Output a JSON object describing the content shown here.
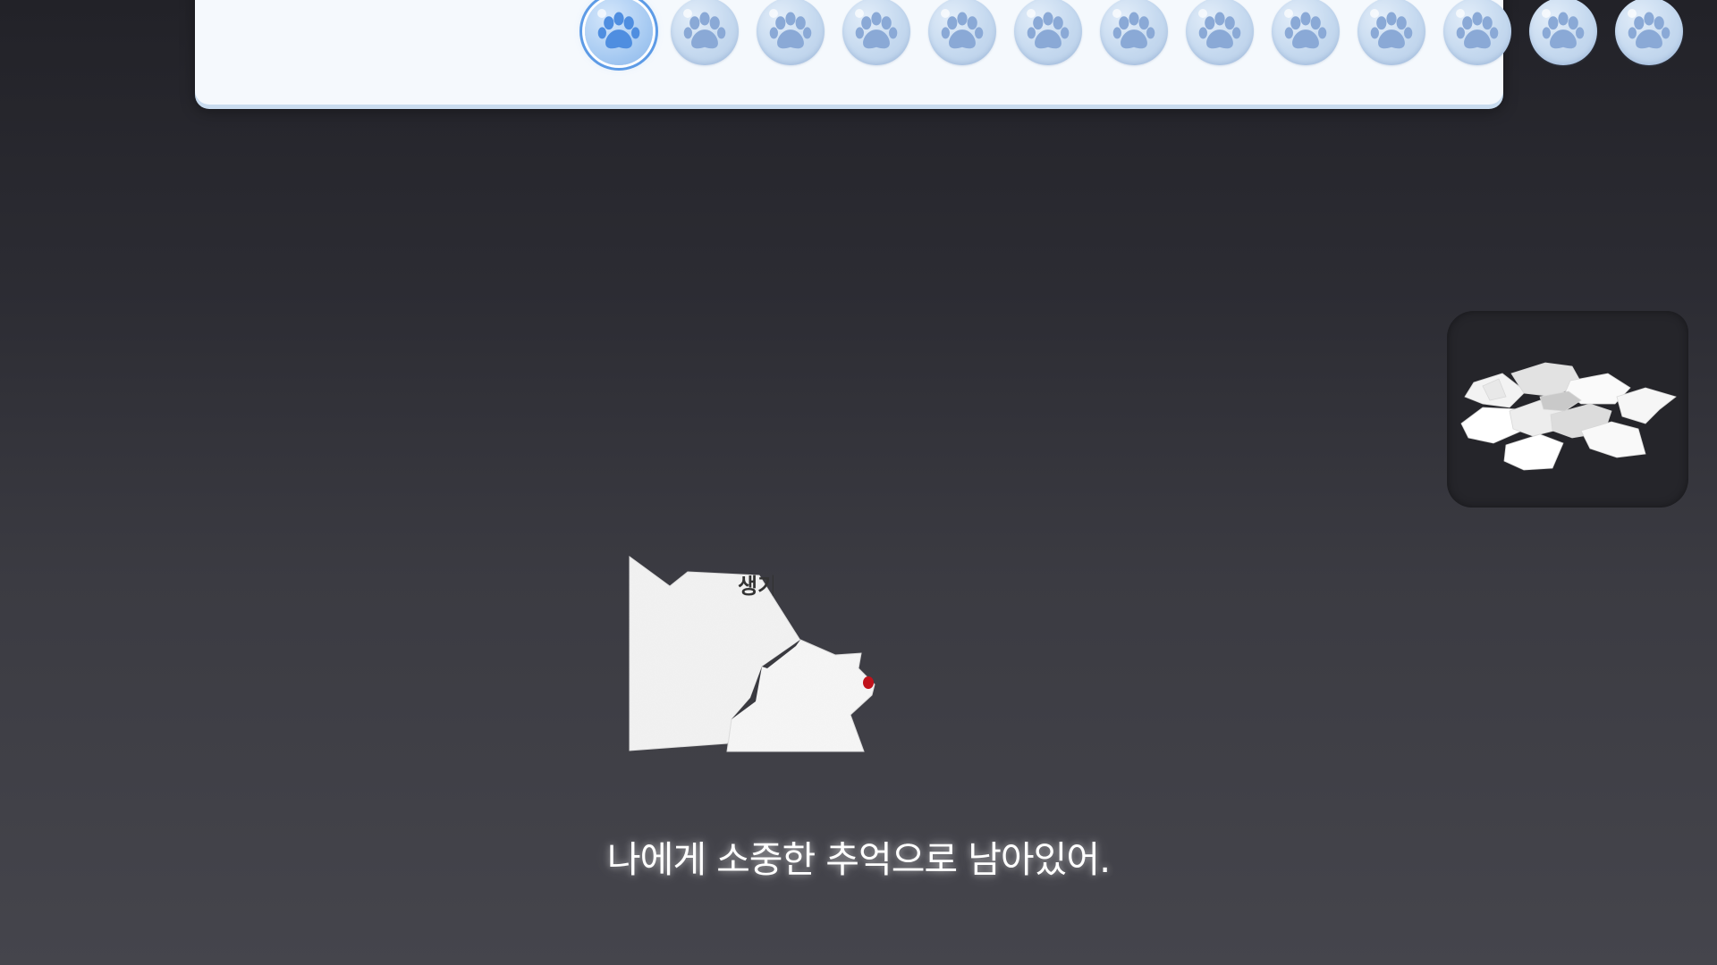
{
  "stages": {
    "count": 13,
    "active_index": 0,
    "icon": "paw-icon"
  },
  "puzzle": {
    "partial_text": "생기"
  },
  "collected_pieces": {
    "icon": "paper-pieces-icon"
  },
  "subtitle": "나에게 소중한 추억으로 남아있어.",
  "colors": {
    "paw_fill": "#8aa9d6",
    "paw_active_fill": "#4f8ee0",
    "paper": "#f4f4f4",
    "accent_red": "#c0121b"
  }
}
